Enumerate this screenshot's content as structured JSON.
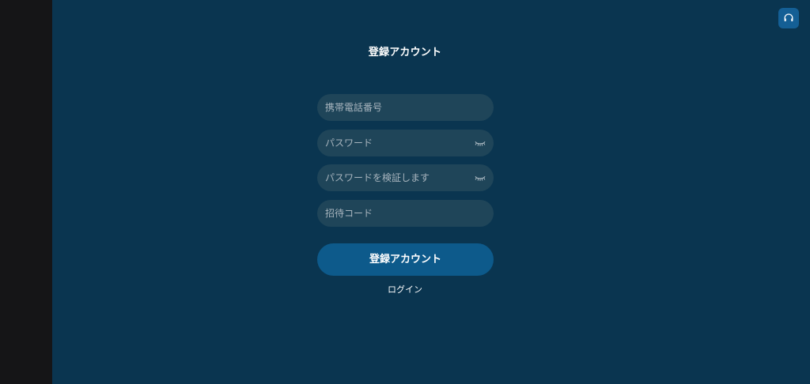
{
  "header": {
    "title": "登録アカウント"
  },
  "form": {
    "phone_placeholder": "携帯電話番号",
    "password_placeholder": "パスワード",
    "confirm_password_placeholder": "パスワードを検証します",
    "invite_code_placeholder": "招待コード",
    "submit_label": "登録アカウント"
  },
  "footer": {
    "login_label": "ログイン"
  },
  "icons": {
    "support": "headset-icon",
    "toggle_password": "eye-closed-icon"
  },
  "colors": {
    "background": "#0a3550",
    "left_bar": "#151517",
    "field": "#1f4559",
    "button": "#0d5a8b",
    "support_button": "#145f95"
  }
}
